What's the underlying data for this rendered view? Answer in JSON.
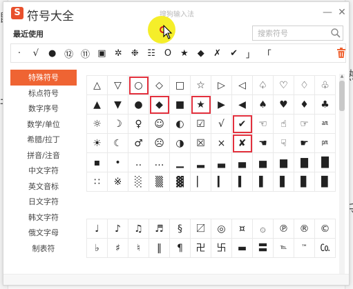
{
  "background": {
    "left_glyphs": [
      "旣",
      "刊"
    ],
    "right_glyphs": [
      "熟",
      "乐"
    ]
  },
  "titlebar": {
    "logo_glyph": "S",
    "title": "符号大全",
    "ime_name": "搜狗输入法",
    "minimize_glyph": "—",
    "close_glyph": "✕"
  },
  "recent": {
    "label": "最近使用",
    "symbols": [
      "·",
      "√",
      "●",
      "⑫",
      "⑪",
      "▣",
      "✲",
      "❉",
      "☷",
      "O",
      "★",
      "◆",
      "✗",
      "✔",
      "」",
      "「"
    ]
  },
  "search": {
    "placeholder": "搜索符号",
    "value": ""
  },
  "categories": {
    "active_index": 0,
    "items": [
      "特殊符号",
      "标点符号",
      "数字序号",
      "数学/单位",
      "希腊/拉丁",
      "拼音/注音",
      "中文字符",
      "英文音标",
      "日文字符",
      "韩文字符",
      "俄文字母",
      "制表符"
    ]
  },
  "grid_top": {
    "rows": [
      [
        "△",
        "▽",
        "○",
        "◇",
        "□",
        "☆",
        "▷",
        "◁",
        "♤",
        "♡",
        "♢",
        "♧"
      ],
      [
        "▲",
        "▼",
        "●",
        "◆",
        "■",
        "★",
        "▶",
        "◀",
        "♠",
        "♥",
        "♦",
        "♣"
      ],
      [
        "☼",
        "☽",
        "♀",
        "☺",
        "◐",
        "☑",
        "√",
        "✔",
        "☜",
        "☝",
        "☞",
        "㏂"
      ],
      [
        "☀",
        "☾",
        "♂",
        "☹",
        "◑",
        "☒",
        "×",
        "✘",
        "☚",
        "☟",
        "☛",
        "㏘"
      ],
      [
        "▪",
        "•",
        "‥",
        "…",
        "▁",
        "▂",
        "▃",
        "▄",
        "▅",
        "▆",
        "▇",
        "█"
      ],
      [
        "∷",
        "※",
        "░",
        "▒",
        "▓",
        "▏",
        "▎",
        "▍",
        "▌",
        "▋",
        "▊",
        "▉"
      ]
    ]
  },
  "grid_bottom": {
    "rows": [
      [
        "♩",
        "♪",
        "♫",
        "♬",
        "§",
        "〼",
        "◎",
        "¤",
        "۞",
        "℗",
        "®",
        "©"
      ],
      [
        "♭",
        "♯",
        "♮",
        "‖",
        "¶",
        "卍",
        "卐",
        "▬",
        "〓",
        "℡",
        "™",
        "㏇"
      ]
    ]
  },
  "colors": {
    "accent": "#ef6433",
    "highlight_box": "#e3303d",
    "cursor_halo": "#f5ee2a",
    "logo": "#e8502c"
  }
}
